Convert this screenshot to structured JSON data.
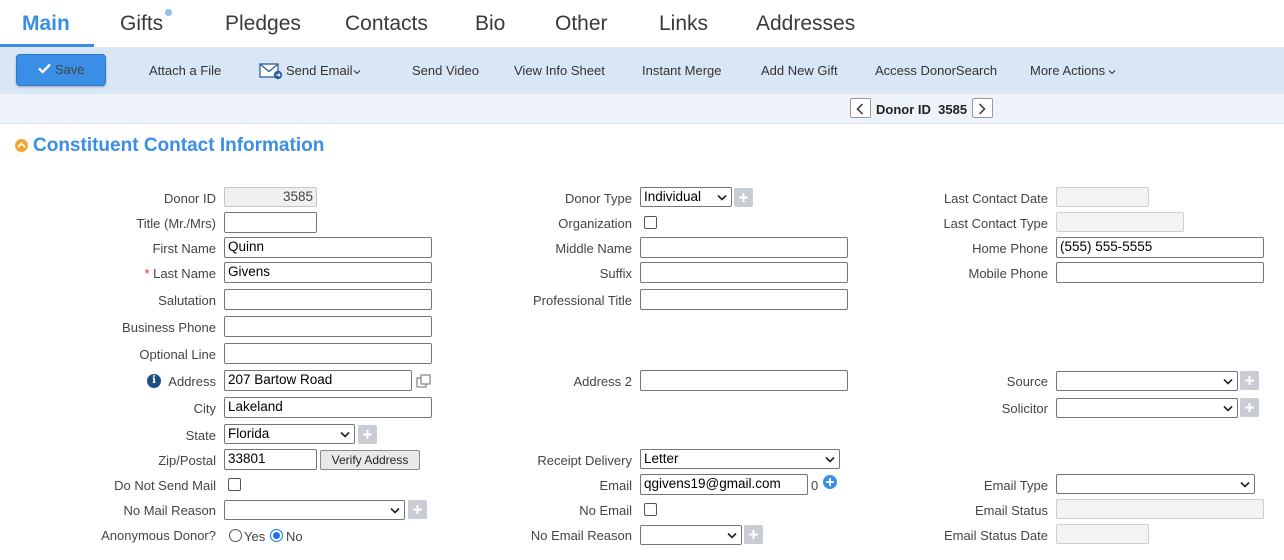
{
  "tabs": {
    "main": "Main",
    "gifts": "Gifts",
    "pledges": "Pledges",
    "contacts": "Contacts",
    "bio": "Bio",
    "other": "Other",
    "links": "Links",
    "addresses": "Addresses"
  },
  "toolbar": {
    "save": "Save",
    "attach_file": "Attach a File",
    "send_email": "Send Email",
    "send_video": "Send Video",
    "view_info_sheet": "View Info Sheet",
    "instant_merge": "Instant Merge",
    "add_new_gift": "Add New Gift",
    "access_donorsearch": "Access DonorSearch",
    "more_actions": "More Actions"
  },
  "navigator": {
    "label": "Donor ID",
    "donor_id": "3585"
  },
  "section": {
    "title": "Constituent Contact Information"
  },
  "labels": {
    "donor_id": "Donor ID",
    "title": "Title (Mr./Mrs)",
    "first_name": "First Name",
    "last_name": "Last Name",
    "salutation": "Salutation",
    "business_phone": "Business Phone",
    "optional_line": "Optional Line",
    "address": "Address",
    "city": "City",
    "state": "State",
    "zip": "Zip/Postal",
    "do_not_send_mail": "Do Not Send Mail",
    "no_mail_reason": "No Mail Reason",
    "anonymous_donor": "Anonymous Donor?",
    "donor_type": "Donor Type",
    "organization": "Organization",
    "middle_name": "Middle Name",
    "suffix": "Suffix",
    "professional_title": "Professional Title",
    "address2": "Address 2",
    "receipt_delivery": "Receipt Delivery",
    "email": "Email",
    "no_email": "No Email",
    "no_email_reason": "No Email Reason",
    "last_contact_date": "Last Contact Date",
    "last_contact_type": "Last Contact Type",
    "home_phone": "Home Phone",
    "mobile_phone": "Mobile Phone",
    "source": "Source",
    "solicitor": "Solicitor",
    "email_type": "Email Type",
    "email_status": "Email Status",
    "email_status_date": "Email Status Date",
    "yes": "Yes",
    "no": "No",
    "verify_address": "Verify Address"
  },
  "values": {
    "donor_id": "3585",
    "title": "",
    "first_name": "Quinn",
    "last_name": "Givens",
    "salutation": "",
    "business_phone": "",
    "optional_line": "",
    "address": "207 Bartow Road",
    "city": "Lakeland",
    "state": "Florida",
    "zip": "33801",
    "no_mail_reason": "",
    "donor_type": "Individual",
    "middle_name": "",
    "suffix": "",
    "professional_title": "",
    "address2": "",
    "receipt_delivery": "Letter",
    "email": "qgivens19@gmail.com",
    "email_count": "0",
    "no_email_reason": "",
    "last_contact_date": "",
    "last_contact_type": "",
    "home_phone": "(555) 555-5555",
    "mobile_phone": "",
    "source": "",
    "solicitor": "",
    "email_type": "",
    "email_status": "",
    "email_status_date": "",
    "anonymous": "No"
  },
  "colors": {
    "accent": "#3b8ee6",
    "toolbar_bg": "#d8e6f6",
    "required": "#d9302c"
  }
}
